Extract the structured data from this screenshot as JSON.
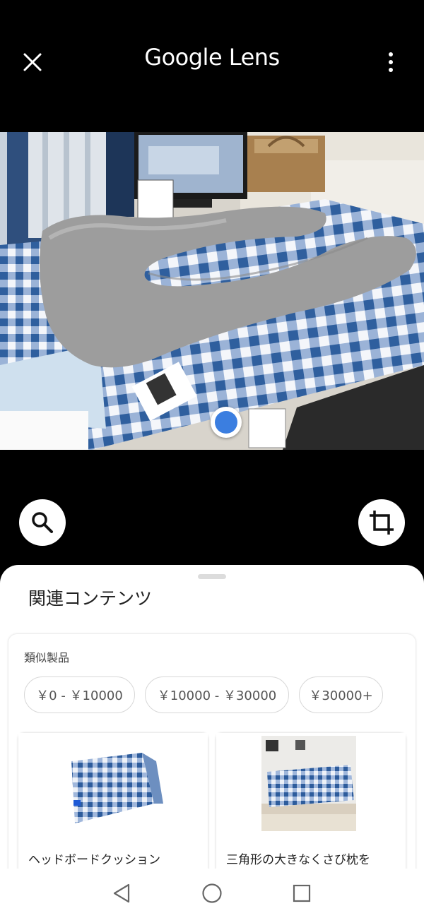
{
  "header": {
    "title": "Google Lens",
    "close_icon": "close-icon",
    "more_icon": "more-vert-icon"
  },
  "photo": {
    "alt": "grey U-shaped body pillow on a blue and white checked mattress in a store"
  },
  "actions": {
    "search_icon": "search-icon",
    "crop_icon": "crop-icon"
  },
  "sheet": {
    "title": "関連コンテンツ",
    "section_label": "類似製品",
    "price_chips": [
      "￥0 - ￥10000",
      "￥10000 - ￥30000",
      "￥30000+"
    ],
    "products": [
      {
        "name": "ヘッドボードクッション"
      },
      {
        "name": "三角形の大きなくさび枕を"
      }
    ]
  },
  "nav": {
    "back_icon": "back-icon",
    "home_icon": "home-icon",
    "recents_icon": "recents-icon"
  },
  "colors": {
    "accent": "#3b7ee0",
    "pillow": "#9d9d9d",
    "check_blue": "#3e6ea8"
  }
}
